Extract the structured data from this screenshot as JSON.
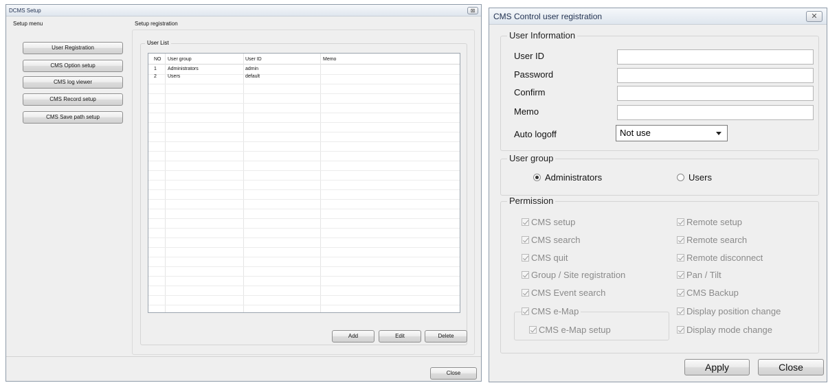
{
  "setup_window": {
    "title": "DCMS Setup",
    "close_glyph": "⊠",
    "setup_menu_label": "Setup menu",
    "setup_registration_label": "Setup registration",
    "menu_buttons": [
      "User Registration",
      "CMS Option setup",
      "CMS log viewer",
      "CMS Record setup",
      "CMS Save path setup"
    ],
    "user_list_label": "User List",
    "columns": [
      "NO",
      "User group",
      "User ID",
      "Memo"
    ],
    "rows": [
      {
        "no": "1",
        "group": "Administrators",
        "id": "admin",
        "memo": ""
      },
      {
        "no": "2",
        "group": "Users",
        "id": "default",
        "memo": ""
      }
    ],
    "add_label": "Add",
    "edit_label": "Edit",
    "delete_label": "Delete",
    "close_label": "Close"
  },
  "registration_window": {
    "title": "CMS Control user registration",
    "close_glyph": "✕",
    "user_info_legend": "User Information",
    "fields": {
      "user_id_label": "User ID",
      "password_label": "Password",
      "confirm_label": "Confirm",
      "memo_label": "Memo",
      "auto_logoff_label": "Auto logoff",
      "auto_logoff_value": "Not use"
    },
    "user_group_legend": "User group",
    "group_options": [
      "Administrators",
      "Users"
    ],
    "selected_group": "Administrators",
    "permission_legend": "Permission",
    "permissions_left": [
      "CMS setup",
      "CMS search",
      "CMS quit",
      "Group / Site registration",
      "CMS Event search",
      "CMS e-Map"
    ],
    "emap_sub": "CMS e-Map setup",
    "permissions_right": [
      "Remote setup",
      "Remote search",
      "Remote disconnect",
      "Pan / Tilt",
      "CMS Backup",
      "Display position change",
      "Display mode change"
    ],
    "apply_label": "Apply",
    "close_label": "Close"
  }
}
